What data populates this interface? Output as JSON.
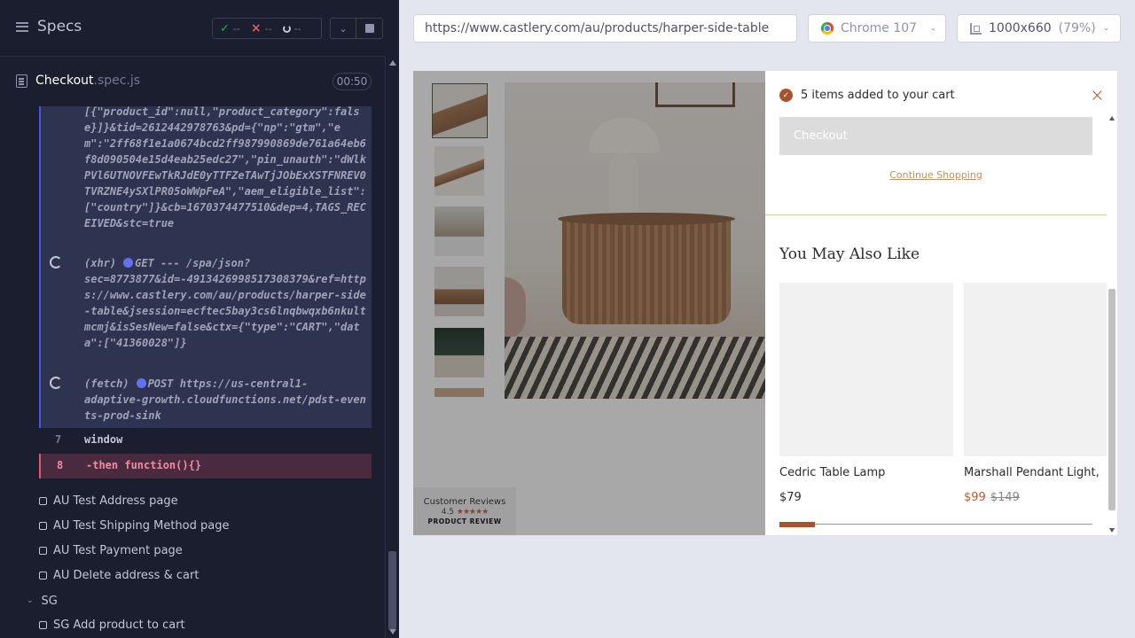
{
  "runner": {
    "title": "Specs",
    "stats": {
      "passed": "--",
      "failed": "--",
      "pending": "--"
    },
    "spec": {
      "name": "Checkout",
      "ext": ".spec.js",
      "timer": "00:50"
    },
    "log": [
      {
        "text": "[{\"product_id\":null,\"product_category\":false}]}&tid=2612442978763&pd={\"np\":\"gtm\",\"em\":\"2ff68f1e1a0674bcd2ff987990869de761a64eb6f8d090504e15d4eab25edc27\",\"pin_unauth\":\"dWlkPVl6UTNOVFEwTkRJdE0yTTFZeTAwTjJObExXSTFNREV0TVRZNE4ySXlPR05oWWpFeA\",\"aem_eligible_list\":[\"country\"]}&cb=1670374477510&dep=4,TAGS_RECEIVED&stc=true"
      },
      {
        "tag": "(xhr)",
        "method": "GET --- /spa/json?",
        "text": "sec=8773877&id=-4913426998517308379&ref=https://www.castlery.com/au/products/harper-side-table&jsession=ecftec5bay3cs6lnqbwqxb6nkultmcmj&isSesNew=false&ctx={\"type\":\"CART\",\"data\":[\"41360028\"]}"
      },
      {
        "tag": "(fetch)",
        "method": "POST https://us-central1-",
        "text": "adaptive-growth.cloudfunctions.net/pdst-events-prod-sink"
      }
    ],
    "code_lines": [
      {
        "num": "7",
        "code": "window"
      },
      {
        "num": "8",
        "code": "-then  function(){}"
      }
    ],
    "tests": [
      "AU Test Address page",
      "AU Test Shipping Method page",
      "AU Test Payment page",
      "AU Delete address & cart"
    ],
    "suite": {
      "name": "SG",
      "first_test": "SG Add product to cart"
    }
  },
  "aut": {
    "url": "https://www.castlery.com/au/products/harper-side-table",
    "browser": "Chrome 107",
    "viewport": "1000x660",
    "scale": "(79%)",
    "reviews": {
      "label": "Customer Reviews",
      "rating": "4.5",
      "stars": "★★★★★",
      "brand": "PRODUCT REVIEW"
    },
    "cart": {
      "added_message": "5 items added to your cart",
      "close": "×",
      "checkout_label": "Checkout",
      "continue_label": "Continue Shopping",
      "also_like_title": "You May Also Like",
      "products": [
        {
          "name": "Cedric Table Lamp",
          "price": "$79"
        },
        {
          "name": "Marshall Pendant Light,",
          "sale_price": "$99",
          "was_price": "$149"
        }
      ]
    }
  }
}
